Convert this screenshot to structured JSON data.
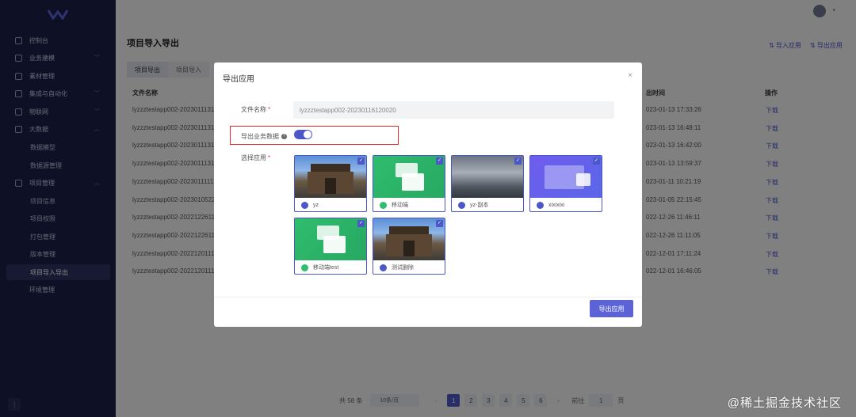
{
  "sidebar": {
    "items": [
      {
        "label": "控制台",
        "chevron": ""
      },
      {
        "label": "业务建模",
        "chevron": "﹀"
      },
      {
        "label": "素材管理",
        "chevron": ""
      },
      {
        "label": "集成与自动化",
        "chevron": "﹀"
      },
      {
        "label": "物联网",
        "chevron": "﹀"
      },
      {
        "label": "大数据",
        "chevron": "︿"
      }
    ],
    "bigdata_sub": [
      "数据模型",
      "数据源管理"
    ],
    "project": {
      "label": "项目管理",
      "chevron": "︿"
    },
    "project_sub": [
      "项目信息",
      "项目权限",
      "打包管理",
      "版本管理",
      "项目导入导出"
    ],
    "env": "环境管理",
    "collapse": "⟨"
  },
  "header": {
    "title": "项目导入导出",
    "import_btn": "⇅ 导入应用",
    "export_btn": "⇅ 导出应用"
  },
  "tabs": [
    "项目导出",
    "项目导入"
  ],
  "table": {
    "headers": {
      "filename": "文件名称",
      "time": "出时间",
      "ops": "操作"
    },
    "rows": [
      {
        "name": "lyzzztestapp002-2023011131",
        "time": "023-01-13 17:33:26",
        "op": "下载"
      },
      {
        "name": "lyzzztestapp002-2023011131",
        "time": "023-01-13 16:48:11",
        "op": "下载"
      },
      {
        "name": "lyzzztestapp002-2023011131",
        "time": "023-01-13 16:42:00",
        "op": "下载"
      },
      {
        "name": "lyzzztestapp002-2023011131",
        "time": "023-01-13 13:59:37",
        "op": "下载"
      },
      {
        "name": "lyzzztestapp002-2023011111",
        "time": "023-01-11 10:21:19",
        "op": "下载"
      },
      {
        "name": "lyzzztestapp002-2023010522",
        "time": "023-01-05 22:15:45",
        "op": "下载"
      },
      {
        "name": "lyzzztestapp002-2022122611",
        "time": "022-12-26 11:46:11",
        "op": "下载"
      },
      {
        "name": "lyzzztestapp002-2022122611",
        "time": "022-12-26 11:11:05",
        "op": "下载"
      },
      {
        "name": "lyzzztestapp002-2022120111",
        "time": "022-12-01 17:11:24",
        "op": "下载"
      },
      {
        "name": "lyzzztestapp002-2022120111",
        "time": "022-12-01 16:46:05",
        "op": "下载"
      }
    ]
  },
  "pager": {
    "total": "共 58 条",
    "page_size": "10条/页",
    "prev": "‹",
    "pages": [
      "1",
      "2",
      "3",
      "4",
      "5",
      "6"
    ],
    "next": "›",
    "goto": "前往",
    "goto_value": "1",
    "page_suffix": "页",
    "current_page": 1
  },
  "watermark": "@稀土掘金技术社区",
  "modal": {
    "title": "导出应用",
    "close": "×",
    "filename_label": "文件名称",
    "filename_value": "lyzzztestapp002-20230116120020",
    "export_data_label": "导出业务数据",
    "export_data_on": true,
    "select_label": "选择应用",
    "required_mark": "*",
    "help_icon": "?",
    "apps": [
      {
        "name": "yz",
        "thumb": "photo",
        "icon_color": "#4d58c8",
        "checked": true
      },
      {
        "name": "移动端",
        "thumb": "green",
        "icon_color": "#2fbd6e",
        "checked": true
      },
      {
        "name": "yz-副本",
        "thumb": "cloud",
        "icon_color": "#4d58c8",
        "checked": true
      },
      {
        "name": "xixixixi",
        "thumb": "purple",
        "icon_color": "#4d58c8",
        "checked": true
      },
      {
        "name": "移动端test",
        "thumb": "green",
        "icon_color": "#2fbd6e",
        "checked": true
      },
      {
        "name": "测试删除",
        "thumb": "photo",
        "icon_color": "#4d58c8",
        "checked": true
      }
    ],
    "check_mark": "✓",
    "submit": "导出应用"
  },
  "colors": {
    "accent": "#4d58c8",
    "highlight": "#e22a2a",
    "sidebar": "#1c1f4a"
  }
}
